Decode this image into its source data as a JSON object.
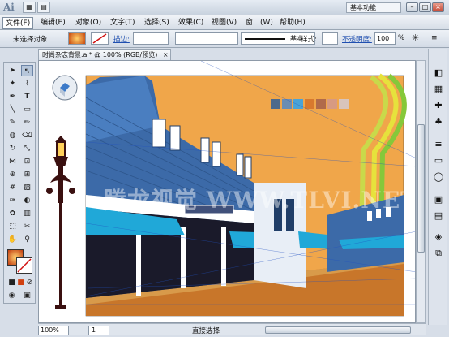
{
  "app": {
    "logo": "Ai"
  },
  "menu": {
    "items": [
      "文件(F)",
      "编辑(E)",
      "对象(O)",
      "文字(T)",
      "选择(S)",
      "效果(C)",
      "视图(V)",
      "窗口(W)",
      "帮助(H)"
    ],
    "workspace": "基本功能",
    "window_buttons": [
      "–",
      "□",
      "×"
    ]
  },
  "control": {
    "selection": "未选择对象",
    "stroke_label": "描边:",
    "brush_label": "基本",
    "style_label": "样式:",
    "opacity_label": "不透明度:",
    "opacity_value": "100",
    "percent": "%"
  },
  "document": {
    "tab": "时尚杂志背景.ai* @ 100% (RGB/预览)",
    "watermark": "腾龙视觉 WWW.TLVI.NET"
  },
  "status": {
    "zoom": "100%",
    "page": "1",
    "current_tool": "直接选择"
  },
  "swatches": [
    "#4d6a8c",
    "#6b8db3",
    "#4aa3d8",
    "#d8792e",
    "#b06a4a",
    "#d79a82",
    "#d8c4bc"
  ],
  "colors": {
    "sky": "#f0a64a",
    "building": "#3c6aa8",
    "awning": "#20a8d8",
    "street": "#c8762a"
  }
}
